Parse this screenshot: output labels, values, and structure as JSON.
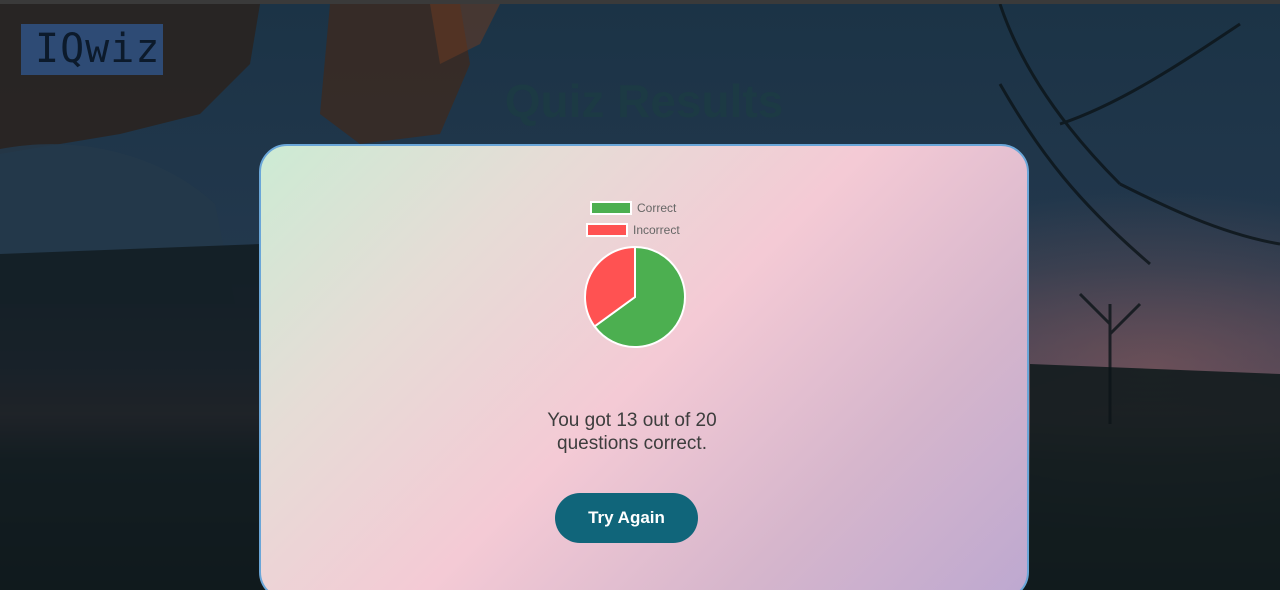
{
  "logo": {
    "text": "IQwiz"
  },
  "page": {
    "title": "Quiz Results"
  },
  "chart_data": {
    "type": "pie",
    "labels": [
      "Correct",
      "Incorrect"
    ],
    "values": [
      13,
      7
    ],
    "colors": [
      "#4caf50",
      "#ff5252"
    ],
    "legend_position": "top"
  },
  "results": {
    "summary": "You got 13 out of 20 questions correct."
  },
  "actions": {
    "try_again_label": "Try Again"
  }
}
